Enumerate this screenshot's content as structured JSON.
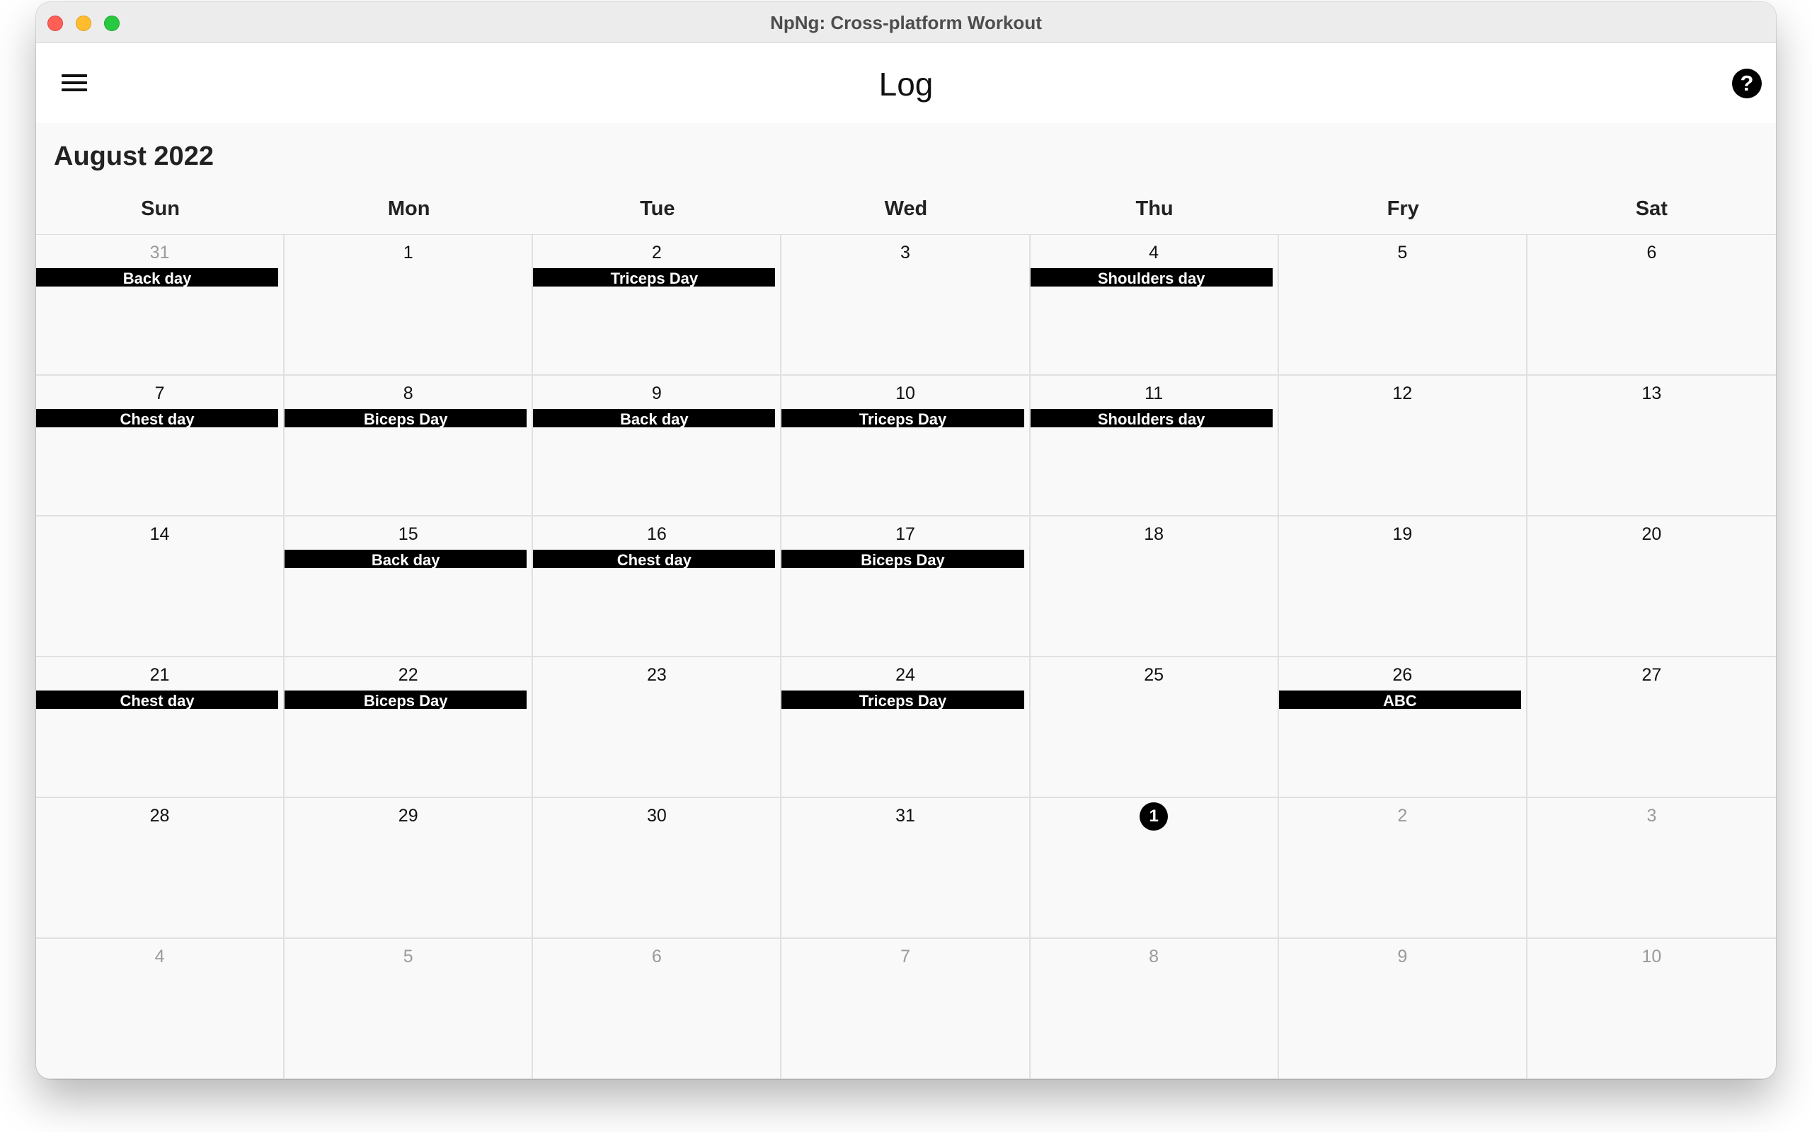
{
  "window": {
    "title": "NpNg: Cross-platform Workout"
  },
  "appbar": {
    "title": "Log",
    "menu_icon": "hamburger-menu-icon",
    "help_icon": "question-mark-icon",
    "help_glyph": "?"
  },
  "calendar": {
    "month_label": "August 2022",
    "weekdays": [
      "Sun",
      "Mon",
      "Tue",
      "Wed",
      "Thu",
      "Fry",
      "Sat"
    ],
    "today_day": "1",
    "days": [
      {
        "day": "31",
        "current_month": false,
        "event": "Back day"
      },
      {
        "day": "1",
        "current_month": true,
        "event": ""
      },
      {
        "day": "2",
        "current_month": true,
        "event": "Triceps Day"
      },
      {
        "day": "3",
        "current_month": true,
        "event": ""
      },
      {
        "day": "4",
        "current_month": true,
        "event": "Shoulders day"
      },
      {
        "day": "5",
        "current_month": true,
        "event": ""
      },
      {
        "day": "6",
        "current_month": true,
        "event": ""
      },
      {
        "day": "7",
        "current_month": true,
        "event": "Chest day"
      },
      {
        "day": "8",
        "current_month": true,
        "event": "Biceps Day"
      },
      {
        "day": "9",
        "current_month": true,
        "event": "Back day"
      },
      {
        "day": "10",
        "current_month": true,
        "event": "Triceps Day"
      },
      {
        "day": "11",
        "current_month": true,
        "event": "Shoulders day"
      },
      {
        "day": "12",
        "current_month": true,
        "event": ""
      },
      {
        "day": "13",
        "current_month": true,
        "event": ""
      },
      {
        "day": "14",
        "current_month": true,
        "event": ""
      },
      {
        "day": "15",
        "current_month": true,
        "event": "Back day"
      },
      {
        "day": "16",
        "current_month": true,
        "event": "Chest day"
      },
      {
        "day": "17",
        "current_month": true,
        "event": "Biceps Day"
      },
      {
        "day": "18",
        "current_month": true,
        "event": ""
      },
      {
        "day": "19",
        "current_month": true,
        "event": ""
      },
      {
        "day": "20",
        "current_month": true,
        "event": ""
      },
      {
        "day": "21",
        "current_month": true,
        "event": "Chest day"
      },
      {
        "day": "22",
        "current_month": true,
        "event": "Biceps Day"
      },
      {
        "day": "23",
        "current_month": true,
        "event": ""
      },
      {
        "day": "24",
        "current_month": true,
        "event": "Triceps Day"
      },
      {
        "day": "25",
        "current_month": true,
        "event": ""
      },
      {
        "day": "26",
        "current_month": true,
        "event": "ABC"
      },
      {
        "day": "27",
        "current_month": true,
        "event": ""
      },
      {
        "day": "28",
        "current_month": true,
        "event": ""
      },
      {
        "day": "29",
        "current_month": true,
        "event": ""
      },
      {
        "day": "30",
        "current_month": true,
        "event": ""
      },
      {
        "day": "31",
        "current_month": true,
        "event": ""
      },
      {
        "day": "1",
        "current_month": false,
        "event": "",
        "today": true
      },
      {
        "day": "2",
        "current_month": false,
        "event": ""
      },
      {
        "day": "3",
        "current_month": false,
        "event": ""
      },
      {
        "day": "4",
        "current_month": false,
        "event": ""
      },
      {
        "day": "5",
        "current_month": false,
        "event": ""
      },
      {
        "day": "6",
        "current_month": false,
        "event": ""
      },
      {
        "day": "7",
        "current_month": false,
        "event": ""
      },
      {
        "day": "8",
        "current_month": false,
        "event": ""
      },
      {
        "day": "9",
        "current_month": false,
        "event": ""
      },
      {
        "day": "10",
        "current_month": false,
        "event": ""
      }
    ]
  },
  "colors": {
    "event_bg": "#000000",
    "event_text": "#ffffff",
    "other_month_text": "#9a9a9a",
    "today_bg": "#000000"
  }
}
